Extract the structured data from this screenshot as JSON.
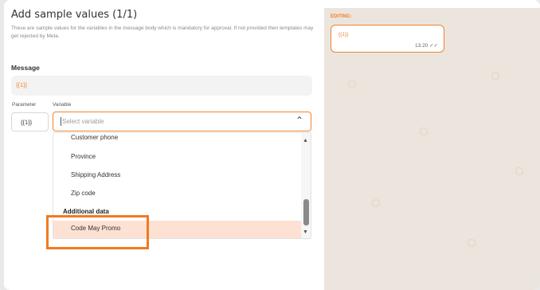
{
  "modal": {
    "title": "Add sample values (1/1)",
    "description": "These are sample values for the variables in the message body which is mandatory for approval. If not provided then templates may get rejected by Meta."
  },
  "message": {
    "label": "Message",
    "value": "{{1}}"
  },
  "parameter": {
    "label": "Parameter",
    "value": "{{1}}"
  },
  "variable": {
    "label": "Variable",
    "placeholder": "Select variable",
    "chevron": "⌃"
  },
  "dropdown": {
    "items": [
      "Customer phone",
      "Province",
      "Shipping Address",
      "Zip code"
    ],
    "group": "Additional data",
    "selected": "Code May Promo"
  },
  "preview": {
    "editing_label": "EDITING:",
    "bubble_variable": "{{1}}",
    "bubble_time": "13.20 ✓✓"
  },
  "colors": {
    "accent": "#f0822e",
    "selected_bg": "#fde1d3",
    "preview_bg": "#ece5dd"
  },
  "icons": {
    "select_chevron": "chevron-up-icon",
    "scroll_up": "scroll-up-arrow-icon",
    "scroll_down": "scroll-down-arrow-icon",
    "read_receipt": "double-check-icon"
  }
}
